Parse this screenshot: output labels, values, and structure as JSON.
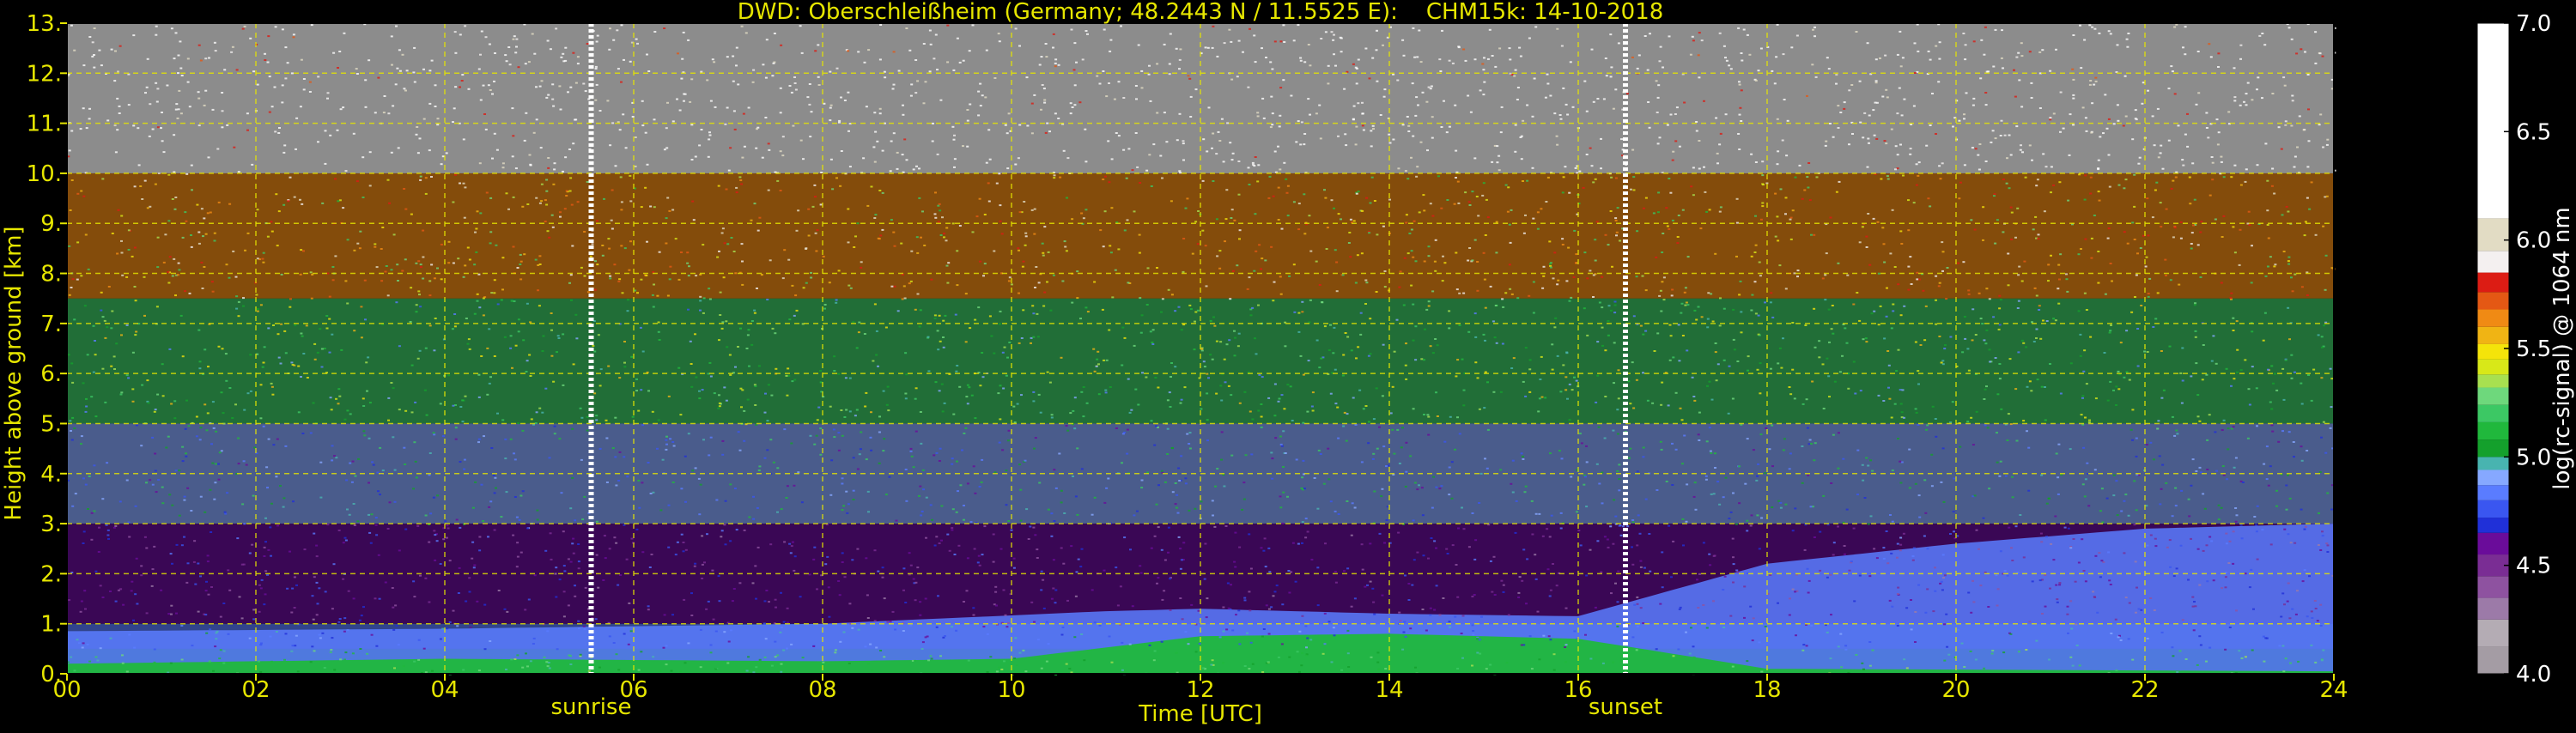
{
  "chart_data": {
    "type": "heatmap",
    "title": "DWD: Oberschleißheim (Germany; 48.2443 N / 11.5525 E):    CHM15k: 14-10-2018",
    "xlabel": "Time [UTC]",
    "ylabel": "Height above ground [km]",
    "xlim": [
      0,
      24
    ],
    "ylim": [
      0,
      13
    ],
    "x_ticks": [
      0,
      2,
      4,
      6,
      8,
      10,
      12,
      14,
      16,
      18,
      20,
      22,
      24
    ],
    "x_tick_labels": [
      "00",
      "02",
      "04",
      "06",
      "08",
      "10",
      "12",
      "14",
      "16",
      "18",
      "20",
      "22",
      "24"
    ],
    "y_ticks": [
      0,
      1,
      2,
      3,
      4,
      5,
      6,
      7,
      8,
      9,
      10,
      11,
      12,
      13
    ],
    "y_tick_labels": [
      "0.",
      "1.",
      "2.",
      "3.",
      "4.",
      "5.",
      "6.",
      "7.",
      "8.",
      "9.",
      "10.",
      "11.",
      "12.",
      "13."
    ],
    "grid": true,
    "markers": [
      {
        "label": "sunrise",
        "time": 5.55
      },
      {
        "label": "sunset",
        "time": 16.5
      }
    ],
    "colorbar": {
      "label": "log(rc-signal) @ 1064 nm",
      "range": [
        4.0,
        7.0
      ],
      "ticks": [
        4.0,
        4.5,
        5.0,
        5.5,
        6.0,
        6.5,
        7.0
      ],
      "tick_labels": [
        "4.0",
        "4.5",
        "5.0",
        "5.5",
        "6.0",
        "6.5",
        "7.0"
      ],
      "colors": [
        {
          "from": 4.0,
          "to": 4.125,
          "color": "#a49ca4"
        },
        {
          "from": 4.125,
          "to": 4.25,
          "color": "#b4acb4"
        },
        {
          "from": 4.25,
          "to": 4.35,
          "color": "#9c7aa8"
        },
        {
          "from": 4.35,
          "to": 4.45,
          "color": "#8e52a0"
        },
        {
          "from": 4.45,
          "to": 4.55,
          "color": "#7a2d94"
        },
        {
          "from": 4.55,
          "to": 4.65,
          "color": "#6a0c9a"
        },
        {
          "from": 4.65,
          "to": 4.72,
          "color": "#2030d8"
        },
        {
          "from": 4.72,
          "to": 4.8,
          "color": "#3a56f0"
        },
        {
          "from": 4.8,
          "to": 4.87,
          "color": "#5a7cff"
        },
        {
          "from": 4.87,
          "to": 4.94,
          "color": "#86a8ff"
        },
        {
          "from": 4.94,
          "to": 5.0,
          "color": "#48b4b0"
        },
        {
          "from": 5.0,
          "to": 5.08,
          "color": "#14a02c"
        },
        {
          "from": 5.08,
          "to": 5.16,
          "color": "#20b83c"
        },
        {
          "from": 5.16,
          "to": 5.24,
          "color": "#3cc864"
        },
        {
          "from": 5.24,
          "to": 5.32,
          "color": "#6ed87c"
        },
        {
          "from": 5.32,
          "to": 5.38,
          "color": "#a8e050"
        },
        {
          "from": 5.38,
          "to": 5.45,
          "color": "#d8e818"
        },
        {
          "from": 5.45,
          "to": 5.52,
          "color": "#f4e40a"
        },
        {
          "from": 5.52,
          "to": 5.6,
          "color": "#f0b414"
        },
        {
          "from": 5.6,
          "to": 5.68,
          "color": "#f08a14"
        },
        {
          "from": 5.68,
          "to": 5.76,
          "color": "#e45814"
        },
        {
          "from": 5.76,
          "to": 5.85,
          "color": "#dc1c14"
        },
        {
          "from": 5.85,
          "to": 5.95,
          "color": "#f4f0f0"
        },
        {
          "from": 5.95,
          "to": 6.1,
          "color": "#e2dcc4"
        },
        {
          "from": 6.1,
          "to": 7.0,
          "color": "#ffffff"
        }
      ]
    },
    "profile_layers": [
      {
        "height_range_km": [
          0.0,
          0.5
        ],
        "dominant_signal": 5.15
      },
      {
        "height_range_km": [
          0.5,
          1.0
        ],
        "dominant_signal": 4.8
      },
      {
        "height_range_km": [
          1.0,
          2.0
        ],
        "dominant_signal": 4.55
      },
      {
        "height_range_km": [
          2.0,
          3.0
        ],
        "dominant_signal": 4.6
      },
      {
        "height_range_km": [
          3.0,
          5.0
        ],
        "dominant_signal": 4.9
      },
      {
        "height_range_km": [
          5.0,
          7.5
        ],
        "dominant_signal": 5.2
      },
      {
        "height_range_km": [
          7.5,
          10.0
        ],
        "dominant_signal": 5.6
      },
      {
        "height_range_km": [
          10.0,
          13.0
        ],
        "dominant_signal": 6.3
      }
    ],
    "boundary_layer_top_km": [
      {
        "time": 0,
        "height": 0.85
      },
      {
        "time": 4,
        "height": 0.9
      },
      {
        "time": 8,
        "height": 1.0
      },
      {
        "time": 11,
        "height": 1.25
      },
      {
        "time": 12,
        "height": 1.3
      },
      {
        "time": 14,
        "height": 1.2
      },
      {
        "time": 16,
        "height": 1.15
      },
      {
        "time": 18,
        "height": 2.2
      },
      {
        "time": 20,
        "height": 2.6
      },
      {
        "time": 22,
        "height": 2.9
      },
      {
        "time": 24,
        "height": 3.0
      }
    ],
    "mixed_layer_green_top_km": [
      {
        "time": 0,
        "height": 0.2
      },
      {
        "time": 4,
        "height": 0.3
      },
      {
        "time": 8,
        "height": 0.25
      },
      {
        "time": 10,
        "height": 0.3
      },
      {
        "time": 12,
        "height": 0.75
      },
      {
        "time": 14,
        "height": 0.8
      },
      {
        "time": 16,
        "height": 0.7
      },
      {
        "time": 17,
        "height": 0.4
      },
      {
        "time": 18,
        "height": 0.1
      },
      {
        "time": 24,
        "height": 0.05
      }
    ]
  }
}
